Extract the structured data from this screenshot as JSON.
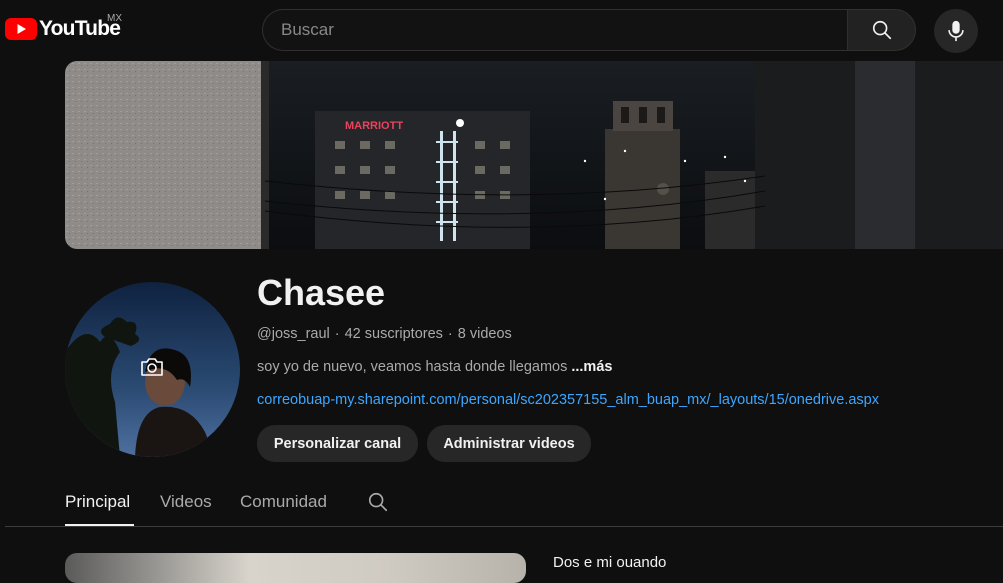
{
  "header": {
    "logo_text": "YouTube",
    "country_code": "MX",
    "search_placeholder": "Buscar",
    "icons": {
      "search": "search-icon",
      "mic": "microphone-icon",
      "logo": "youtube-play-icon"
    }
  },
  "banner": {
    "sign_text": "MARRIOTT"
  },
  "channel": {
    "name": "Chasee",
    "handle": "@joss_raul",
    "separator": "·",
    "subscribers": "42 suscriptores",
    "videos": "8 videos",
    "description": "soy yo de nuevo, veamos hasta donde llegamos",
    "more_label": "...más",
    "link": "correobuap-my.sharepoint.com/personal/sc202357155_alm_buap_mx/_layouts/15/onedrive.aspx",
    "customize_label": "Personalizar canal",
    "manage_label": "Administrar videos"
  },
  "tabs": [
    {
      "label": "Principal",
      "active": true
    },
    {
      "label": "Videos",
      "active": false
    },
    {
      "label": "Comunidad",
      "active": false
    }
  ],
  "featured": {
    "title_partial": "Dos e mi ouando"
  },
  "colors": {
    "background": "#0f0f0f",
    "link": "#3ea6ff",
    "logo_red": "#ff0000",
    "button_bg": "#272727"
  }
}
